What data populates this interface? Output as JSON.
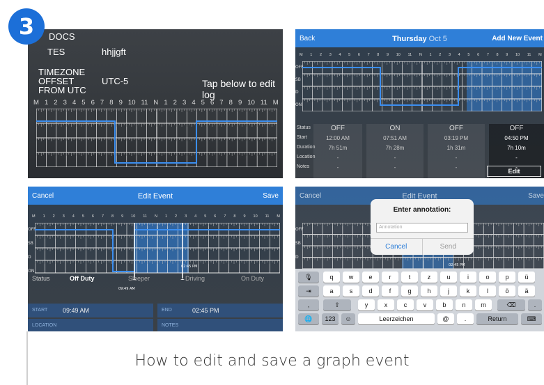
{
  "badge": "3",
  "caption": "How to edit and save a graph event",
  "p1": {
    "docs": "DOCS",
    "notes_label": "TES",
    "notes_value": "hhjjgft",
    "tz_label_1": "TIMEZONE",
    "tz_label_2": "OFFSET",
    "tz_label_3": "FROM UTC",
    "tz_value": "UTC-5",
    "tap_text": "Tap below to edit log"
  },
  "hours": [
    "M",
    "1",
    "2",
    "3",
    "4",
    "5",
    "6",
    "7",
    "8",
    "9",
    "10",
    "11",
    "N",
    "1",
    "2",
    "3",
    "4",
    "5",
    "6",
    "7",
    "8",
    "9",
    "10",
    "11",
    "M"
  ],
  "rows": [
    "OFF",
    "SB",
    "D",
    "ON"
  ],
  "p2": {
    "back": "Back",
    "title": "Thursday",
    "date": "Oct 5",
    "add": "Add New Event",
    "labels": [
      "Status",
      "Start",
      "Duration",
      "Location",
      "Notes"
    ],
    "cols": [
      {
        "status": "OFF",
        "start": "12:00 AM",
        "duration": "7h 51m",
        "loc": "-",
        "notes": "-"
      },
      {
        "status": "ON",
        "start": "07:51 AM",
        "duration": "7h 28m",
        "loc": "-",
        "notes": "-"
      },
      {
        "status": "OFF",
        "start": "03:19 PM",
        "duration": "1h 31m",
        "loc": "-",
        "notes": "-"
      },
      {
        "status": "OFF",
        "start": "04:50 PM",
        "duration": "7h 10m",
        "loc": "-",
        "notes": "-"
      }
    ],
    "edit": "Edit"
  },
  "p3": {
    "cancel": "Cancel",
    "title": "Edit Event",
    "save": "Save",
    "status": "Status",
    "opts": [
      "Off Duty",
      "Sleeper",
      "Driving",
      "On Duty"
    ],
    "start_k": "START",
    "start_v": "09:49 AM",
    "end_k": "END",
    "end_v": "02:45 PM",
    "loc_k": "LOCATION",
    "notes_k": "NOTES",
    "marker1": "09:49 AM",
    "marker2": "02:45 PM"
  },
  "p4": {
    "cancel": "Cancel",
    "title": "Edit Event",
    "save": "Save",
    "dlg_title": "Enter annotation:",
    "placeholder": "Annotation",
    "dlg_cancel": "Cancel",
    "dlg_send": "Send",
    "marker": "02:45 PM",
    "row1": [
      "q",
      "w",
      "e",
      "r",
      "t",
      "z",
      "u",
      "i",
      "o",
      "p",
      "ü"
    ],
    "row2": [
      "a",
      "s",
      "d",
      "f",
      "g",
      "h",
      "j",
      "k",
      "l",
      "ö",
      "ä"
    ],
    "row3": [
      "y",
      "x",
      "c",
      "v",
      "b",
      "n",
      "m"
    ],
    "space": "Leerzeichen",
    "at": "@",
    "dot": ".",
    "ret": "Return",
    "num": "123",
    "comma": ",",
    "period": "."
  },
  "colors": {
    "accent": "#2f7fd8",
    "badge": "#1c6fd8"
  }
}
